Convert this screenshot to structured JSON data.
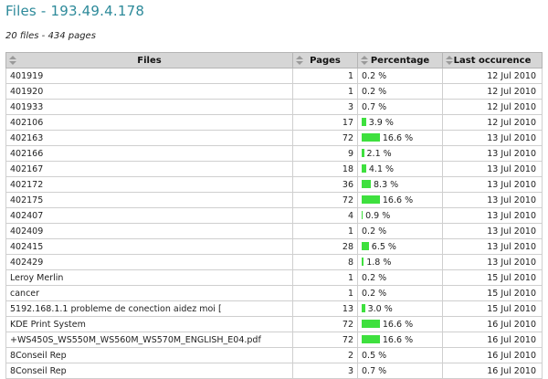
{
  "header": {
    "title": "Files - 193.49.4.178",
    "summary": "20 files - 434 pages"
  },
  "table": {
    "columns": [
      "Files",
      "Pages",
      "Percentage",
      "Last occurence"
    ],
    "rows": [
      {
        "file": "401919",
        "pages": "1",
        "percent": 0.2,
        "percent_text": "0.2 %",
        "date": "12 Jul 2010"
      },
      {
        "file": "401920",
        "pages": "1",
        "percent": 0.2,
        "percent_text": "0.2 %",
        "date": "12 Jul 2010"
      },
      {
        "file": "401933",
        "pages": "3",
        "percent": 0.7,
        "percent_text": "0.7 %",
        "date": "12 Jul 2010"
      },
      {
        "file": "402106",
        "pages": "17",
        "percent": 3.9,
        "percent_text": "3.9 %",
        "date": "12 Jul 2010"
      },
      {
        "file": "402163",
        "pages": "72",
        "percent": 16.6,
        "percent_text": "16.6 %",
        "date": "13 Jul 2010"
      },
      {
        "file": "402166",
        "pages": "9",
        "percent": 2.1,
        "percent_text": "2.1 %",
        "date": "13 Jul 2010"
      },
      {
        "file": "402167",
        "pages": "18",
        "percent": 4.1,
        "percent_text": "4.1 %",
        "date": "13 Jul 2010"
      },
      {
        "file": "402172",
        "pages": "36",
        "percent": 8.3,
        "percent_text": "8.3 %",
        "date": "13 Jul 2010"
      },
      {
        "file": "402175",
        "pages": "72",
        "percent": 16.6,
        "percent_text": "16.6 %",
        "date": "13 Jul 2010"
      },
      {
        "file": "402407",
        "pages": "4",
        "percent": 0.9,
        "percent_text": "0.9 %",
        "date": "13 Jul 2010"
      },
      {
        "file": "402409",
        "pages": "1",
        "percent": 0.2,
        "percent_text": "0.2 %",
        "date": "13 Jul 2010"
      },
      {
        "file": "402415",
        "pages": "28",
        "percent": 6.5,
        "percent_text": "6.5 %",
        "date": "13 Jul 2010"
      },
      {
        "file": "402429",
        "pages": "8",
        "percent": 1.8,
        "percent_text": "1.8 %",
        "date": "13 Jul 2010"
      },
      {
        "file": "Leroy Merlin",
        "pages": "1",
        "percent": 0.2,
        "percent_text": "0.2 %",
        "date": "15 Jul 2010"
      },
      {
        "file": "cancer",
        "pages": "1",
        "percent": 0.2,
        "percent_text": "0.2 %",
        "date": "15 Jul 2010"
      },
      {
        "file": "5192.168.1.1 probleme de conection aidez moi [",
        "pages": "13",
        "percent": 3.0,
        "percent_text": "3.0 %",
        "date": "15 Jul 2010"
      },
      {
        "file": "KDE Print System",
        "pages": "72",
        "percent": 16.6,
        "percent_text": "16.6 %",
        "date": "16 Jul 2010"
      },
      {
        "file": "+WS450S_WS550M_WS560M_WS570M_ENGLISH_E04.pdf",
        "pages": "72",
        "percent": 16.6,
        "percent_text": "16.6 %",
        "date": "16 Jul 2010"
      },
      {
        "file": "8Conseil Rep",
        "pages": "2",
        "percent": 0.5,
        "percent_text": "0.5 %",
        "date": "16 Jul 2010"
      },
      {
        "file": "8Conseil Rep",
        "pages": "3",
        "percent": 0.7,
        "percent_text": "0.7 %",
        "date": "16 Jul 2010"
      }
    ]
  },
  "icons": {
    "sort": "sort-arrows-icon"
  },
  "colors": {
    "title": "#2d8a9a",
    "bar": "#3ee03e",
    "header_bg": "#d6d6d6"
  }
}
